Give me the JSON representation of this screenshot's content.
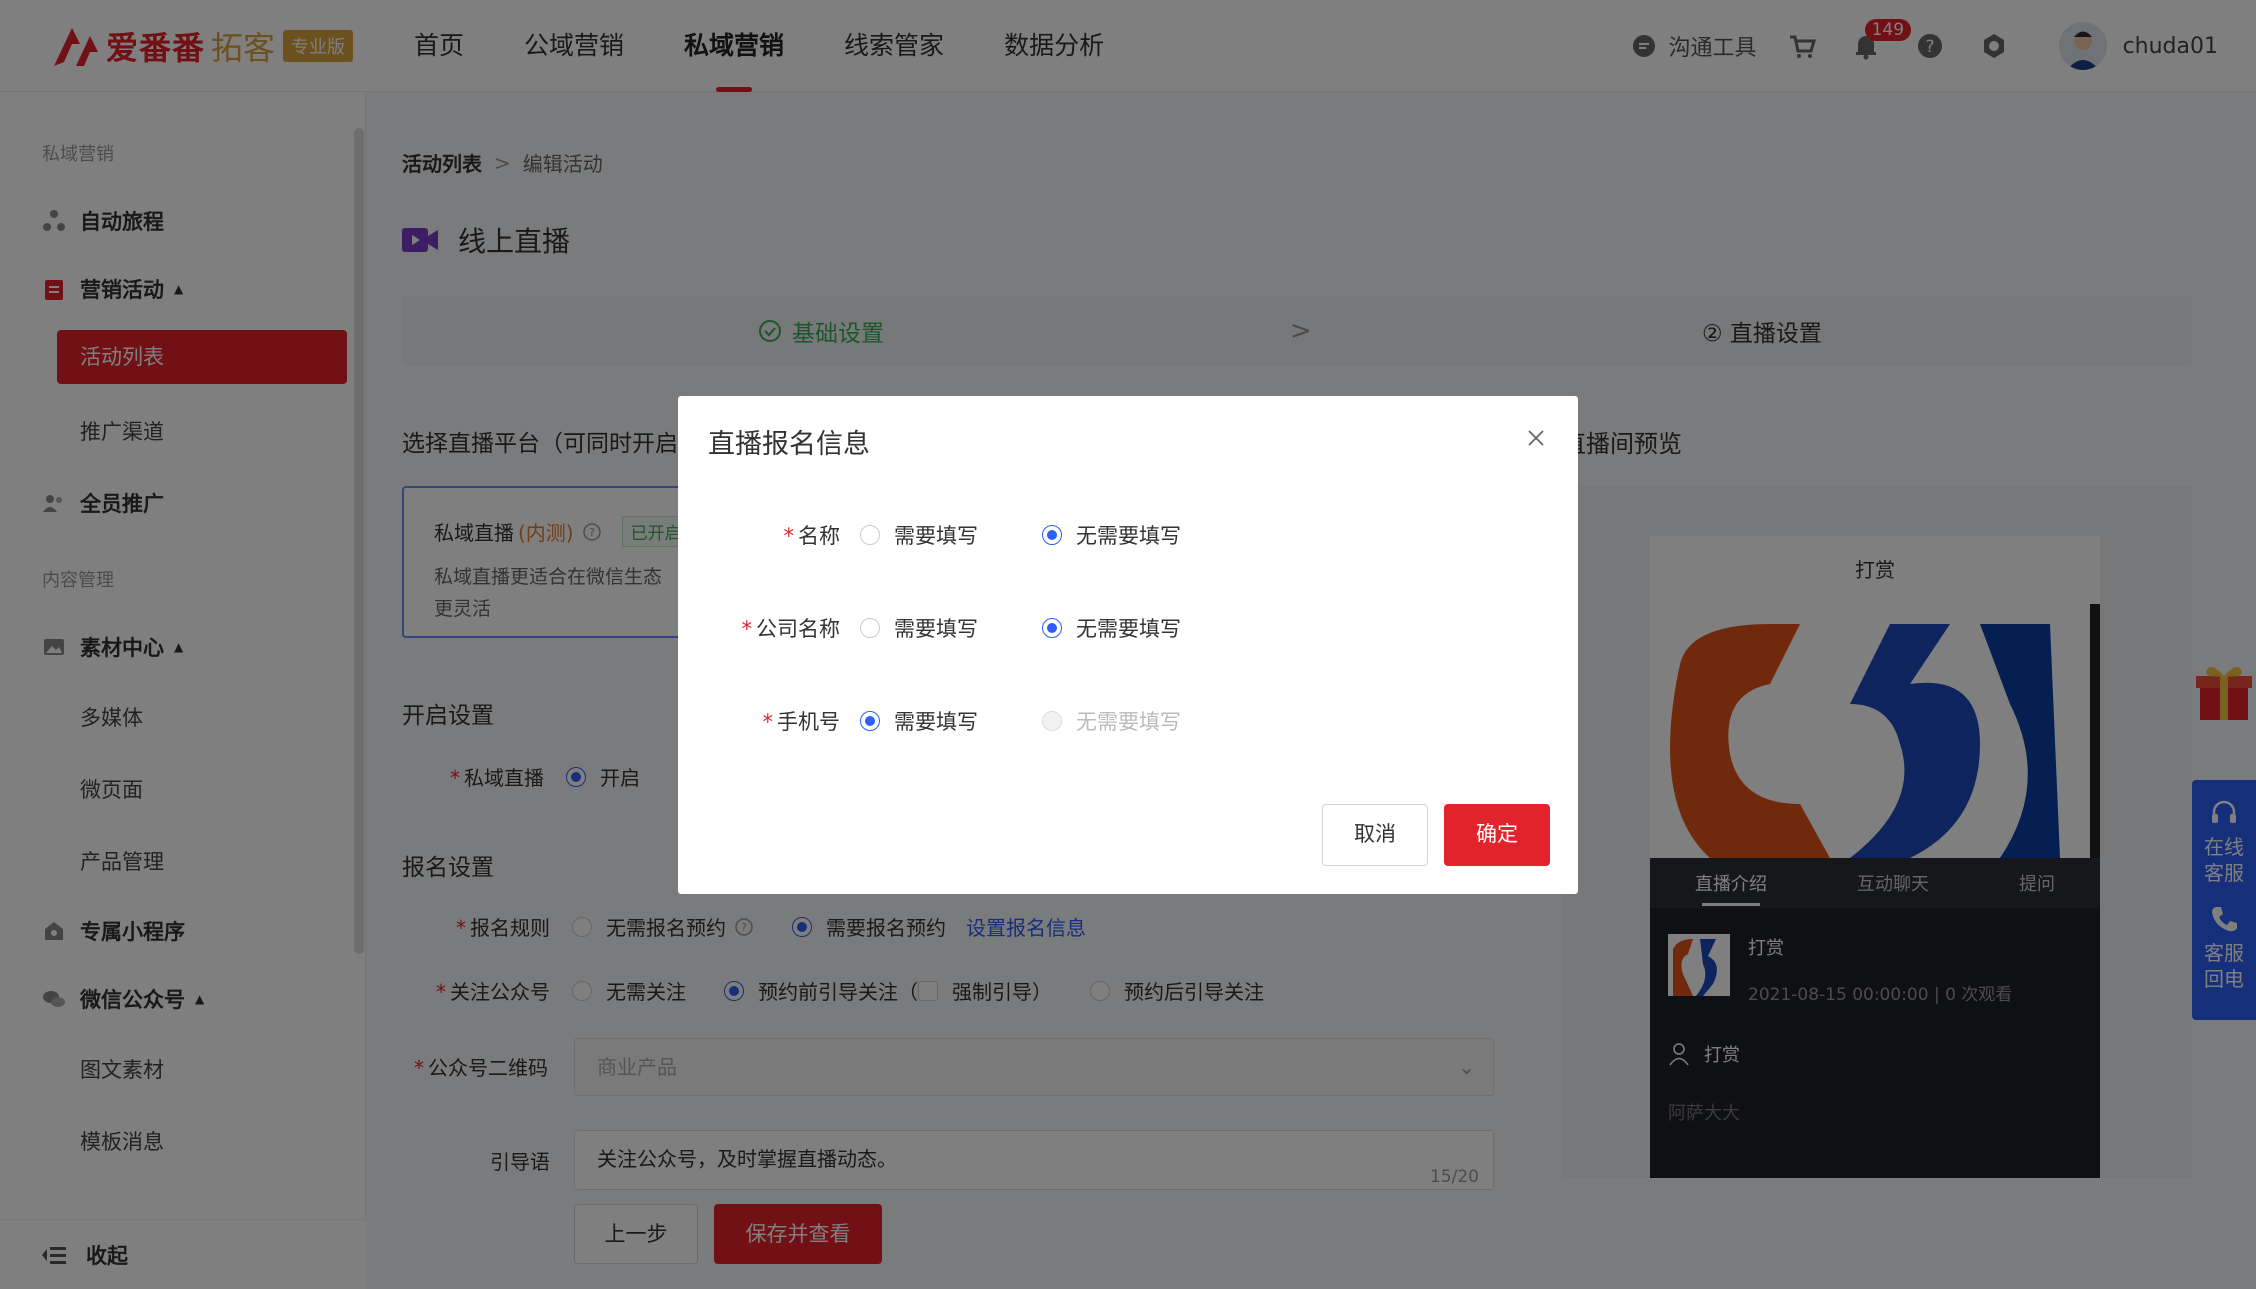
{
  "header": {
    "logo_text": "爱番番",
    "logo_sub": "拓客",
    "logo_badge": "专业版",
    "nav": [
      "首页",
      "公域营销",
      "私域营销",
      "线索管家",
      "数据分析"
    ],
    "active_nav": "私域营销",
    "comm_tool": "沟通工具",
    "notif_count": "149",
    "username": "chuda01"
  },
  "sidebar": {
    "group1": "私域营销",
    "auto_journey": "自动旅程",
    "marketing": "营销活动",
    "activity_list": "活动列表",
    "promo_channel": "推广渠道",
    "all_staff": "全员推广",
    "group2": "内容管理",
    "material_center": "素材中心",
    "multimedia": "多媒体",
    "micro_page": "微页面",
    "product_mgmt": "产品管理",
    "mini_program": "专属小程序",
    "wechat_oa": "微信公众号",
    "graphic_material": "图文素材",
    "template_msg": "模板消息",
    "collapse": "收起"
  },
  "breadcrumb": {
    "root": "活动列表",
    "current": "编辑活动"
  },
  "page_title": "线上直播",
  "steps": {
    "step1": "基础设置",
    "step2": "② 直播设置"
  },
  "platform": {
    "section_title": "选择直播平台（可同时开启",
    "card_title": "私域直播",
    "card_tag_red": "(内测)",
    "card_status": "已开启",
    "card_desc": "私域直播更适合在微信生态",
    "card_desc2": "更灵活"
  },
  "enable": {
    "section_title": "开启设置",
    "label": "私域直播",
    "option": "开启"
  },
  "signup": {
    "section_title": "报名设置",
    "rule_label": "报名规则",
    "rule_opt1": "无需报名预约",
    "rule_opt2": "需要报名预约",
    "rule_link": "设置报名信息",
    "follow_label": "关注公众号",
    "follow_opt1": "无需关注",
    "follow_opt2": "预约前引导关注",
    "follow_paren_open": "（",
    "follow_force": "强制引导",
    "follow_paren_close": "）",
    "follow_opt3": "预约后引导关注",
    "qr_label": "公众号二维码",
    "qr_value": "商业产品",
    "guide_label": "引导语",
    "guide_value": "关注公众号，及时掌握直播动态。",
    "guide_count": "15/20"
  },
  "footer_buttons": {
    "prev": "上一步",
    "save": "保存并查看"
  },
  "preview": {
    "title": "直播间预览",
    "top_title": "打赏",
    "tabs": [
      "直播介绍",
      "互动聊天",
      "提问"
    ],
    "live_name": "打赏",
    "live_meta": "2021-08-15 00:00:00 | 0 次观看",
    "host_name": "打赏",
    "host_desc": "阿萨大大"
  },
  "cs": {
    "online": "在线客服",
    "callback": "客服回电"
  },
  "modal": {
    "title": "直播报名信息",
    "rows": [
      {
        "label": "名称",
        "opt1": "需要填写",
        "opt2": "无需要填写"
      },
      {
        "label": "公司名称",
        "opt1": "需要填写",
        "opt2": "无需要填写"
      },
      {
        "label": "手机号",
        "opt1": "需要填写",
        "opt2": "无需要填写"
      }
    ],
    "cancel": "取消",
    "confirm": "确定"
  },
  "colors": {
    "brand_red": "#e3232c",
    "accent_blue": "#2d5ef5",
    "success_green": "#3daa57"
  }
}
